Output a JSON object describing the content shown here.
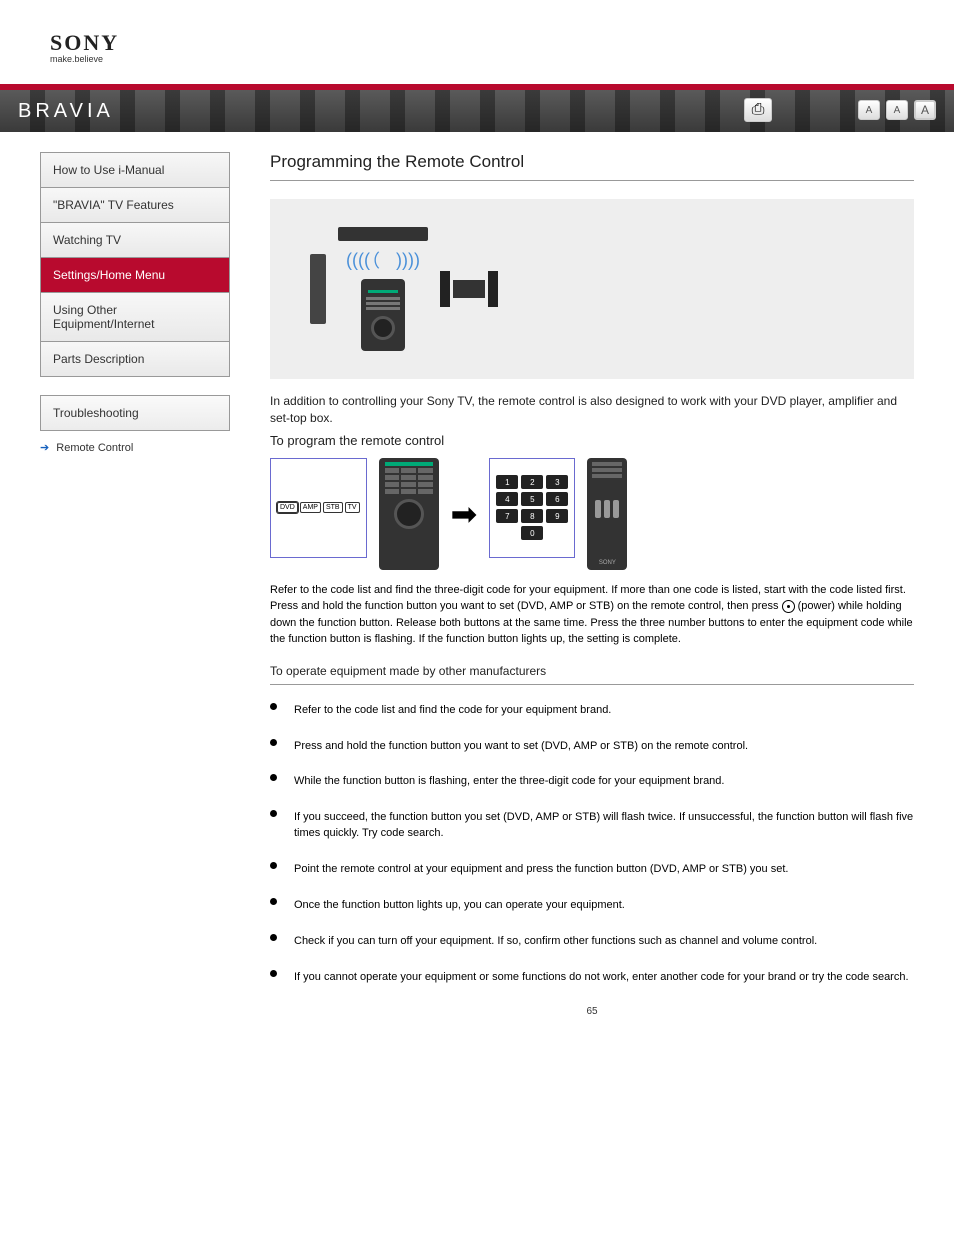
{
  "brand_logo": {
    "name": "SONY",
    "tagline": "make.believe"
  },
  "bravia": "BRAVIA",
  "util": {
    "print": "Print",
    "a1": "A",
    "a2": "A",
    "a3": "A"
  },
  "menu": [
    {
      "label": "How to Use i-Manual",
      "active": false
    },
    {
      "label": "\"BRAVIA\" TV Features",
      "active": false
    },
    {
      "label": "Watching TV",
      "active": false
    },
    {
      "label": "Settings/Home Menu",
      "active": true
    },
    {
      "label": "Using Other Equipment/Internet",
      "active": false
    },
    {
      "label": "Parts Description",
      "active": false
    }
  ],
  "menu2": [
    {
      "label": "Troubleshooting"
    }
  ],
  "breadcrumb": {
    "arrow": "➔",
    "text": "Remote Control"
  },
  "title": "Programming the Remote Control",
  "intro": "In addition to controlling your Sony TV, the remote control is also designed to work with your DVD player, amplifier and set-top box.",
  "program_heading": "To program the remote control",
  "steps_intro_part1": "Refer to the code list and find the three-digit code for your equipment. If more than one code is listed, start with the code listed first. Press and hold the function button you want to set (DVD, AMP or STB) on the remote control, then press ",
  "steps_intro_part2": " (power) while holding down the function button. Release both buttons at the same time. Press the three number buttons to enter the equipment code while the function button is flashing. If the function button lights up, the setting is complete.",
  "steps_heading": "To operate equipment made by other manufacturers",
  "steps": [
    "Refer to the code list and find the code for your equipment brand.",
    "Press and hold the function button you want to set (DVD, AMP or STB) on the remote control.",
    "While the function button is flashing, enter the three-digit code for your equipment brand.",
    "If you succeed, the function button you set (DVD, AMP or STB) will flash twice. If unsuccessful, the function button will flash five times quickly. Try code search.",
    "Point the remote control at your equipment and press the function button (DVD, AMP or STB) you set.",
    "Once the function button lights up, you can operate your equipment.",
    "Check if you can turn off your equipment. If so, confirm other functions such as channel and volume control.",
    "If you cannot operate your equipment or some functions do not work, enter another code for your brand or try the code search."
  ],
  "page_number": "65",
  "func_buttons": [
    "DVD",
    "AMP",
    "STB",
    "TV"
  ],
  "numpad": [
    "1",
    "2",
    "3",
    "4",
    "5",
    "6",
    "7",
    "8",
    "9",
    "0"
  ]
}
